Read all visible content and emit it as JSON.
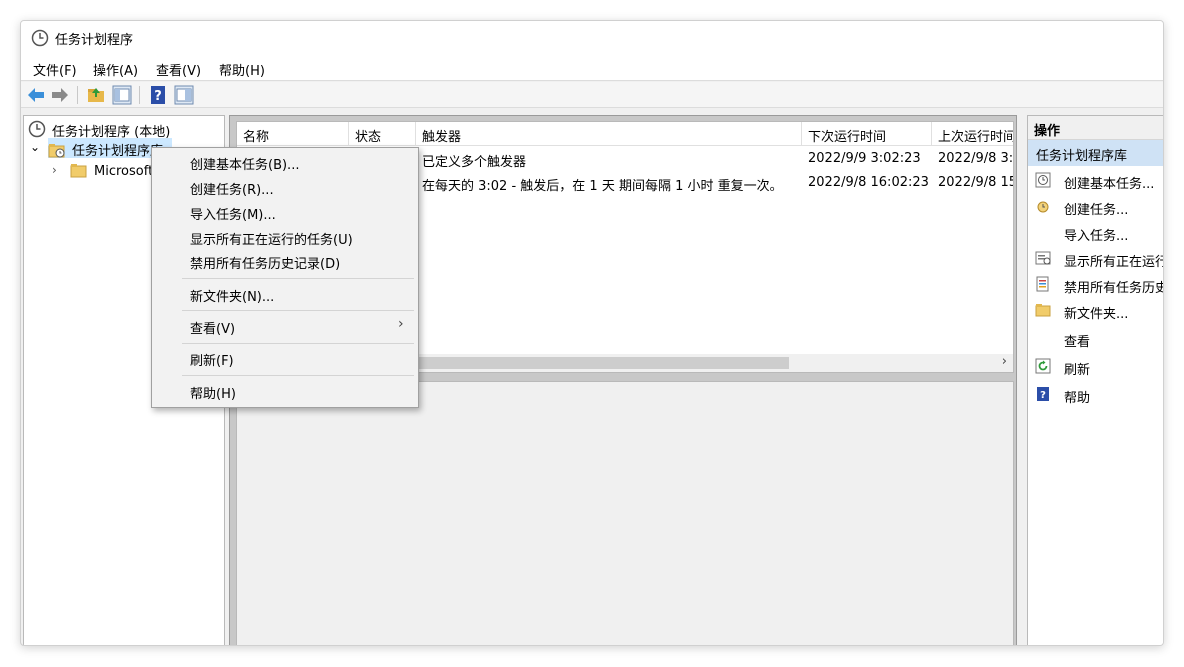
{
  "window": {
    "title": "任务计划程序"
  },
  "menubar": [
    "文件(F)",
    "操作(A)",
    "查看(V)",
    "帮助(H)"
  ],
  "tree": {
    "root": "任务计划程序 (本地)",
    "library": "任务计划程序库",
    "child": "Microsoft"
  },
  "list": {
    "columns": [
      "名称",
      "状态",
      "触发器",
      "下次运行时间",
      "上次运行时间"
    ],
    "rows": [
      {
        "trigger": "已定义多个触发器",
        "next": "2022/9/9 3:02:23",
        "last": "2022/9/8 3:0"
      },
      {
        "trigger": "在每天的 3:02 - 触发后，在 1 天 期间每隔 1 小时 重复一次。",
        "next": "2022/9/8 16:02:23",
        "last": "2022/9/8 15"
      }
    ]
  },
  "actions": {
    "header": "操作",
    "section": "任务计划程序库",
    "items": [
      "创建基本任务...",
      "创建任务...",
      "导入任务...",
      "显示所有正在运行",
      "禁用所有任务历史",
      "新文件夹...",
      "查看",
      "刷新",
      "帮助"
    ]
  },
  "context_menu": {
    "items": [
      "创建基本任务(B)...",
      "创建任务(R)...",
      "导入任务(M)...",
      "显示所有正在运行的任务(U)",
      "禁用所有任务历史记录(D)",
      "新文件夹(N)...",
      "查看(V)",
      "刷新(F)",
      "帮助(H)"
    ],
    "submenu_arrow": "›"
  },
  "colors": {
    "selection": "#cce8ff",
    "section": "#cfe2f5",
    "help_icon": "#2b4ea8"
  }
}
